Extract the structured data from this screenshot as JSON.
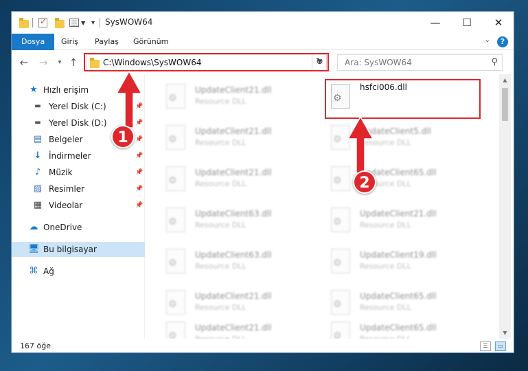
{
  "window": {
    "title": "SysWOW64",
    "controls": {
      "minimize": "—",
      "maximize": "☐",
      "close": "✕"
    }
  },
  "ribbon": {
    "tabs": [
      {
        "label": "Dosya",
        "active": true
      },
      {
        "label": "Giriş"
      },
      {
        "label": "Paylaş"
      },
      {
        "label": "Görünüm"
      }
    ],
    "help": "?"
  },
  "nav": {
    "address": "C:\\Windows\\SysWOW64",
    "search_placeholder": "Ara: SysWOW64"
  },
  "sidebar": {
    "items": [
      {
        "label": "Hızlı erişim",
        "icon": "star-icon",
        "pinned": false
      },
      {
        "label": "Yerel Disk (C:)",
        "icon": "drive-icon",
        "pinned": true
      },
      {
        "label": "Yerel Disk (D:)",
        "icon": "drive-icon",
        "pinned": true
      },
      {
        "label": "Belgeler",
        "icon": "documents-icon",
        "pinned": true
      },
      {
        "label": "İndirmeler",
        "icon": "downloads-icon",
        "pinned": true
      },
      {
        "label": "Müzik",
        "icon": "music-icon",
        "pinned": true
      },
      {
        "label": "Resimler",
        "icon": "pictures-icon",
        "pinned": true
      },
      {
        "label": "Videolar",
        "icon": "videos-icon",
        "pinned": true
      },
      {
        "label": "OneDrive",
        "icon": "cloud-icon",
        "pinned": false
      },
      {
        "label": "Bu bilgisayar",
        "icon": "computer-icon",
        "pinned": false,
        "selected": true
      },
      {
        "label": "Ağ",
        "icon": "network-icon",
        "pinned": false
      }
    ]
  },
  "files": [
    {
      "name": "UpdateClient21.dll",
      "type": "Resource DLL"
    },
    {
      "name": "hsfci006.dll",
      "type": ""
    },
    {
      "name": "UpdateClient21.dll",
      "type": "Resource DLL"
    },
    {
      "name": "UpdateClient5.dll",
      "type": "Resource DLL"
    },
    {
      "name": "UpdateClient21.dll",
      "type": "Resource DLL"
    },
    {
      "name": "UpdateClient65.dll",
      "type": "Resource DLL"
    },
    {
      "name": "UpdateClient63.dll",
      "type": "Resource DLL"
    },
    {
      "name": "UpdateClient21.dll",
      "type": "Resource DLL"
    },
    {
      "name": "UpdateClient63.dll",
      "type": "Resource DLL"
    },
    {
      "name": "UpdateClient19.dll",
      "type": "Resource DLL"
    },
    {
      "name": "UpdateClient21.dll",
      "type": "Resource DLL"
    },
    {
      "name": "UpdateClient65.dll",
      "type": "Resource DLL"
    },
    {
      "name": "UpdateClient21.dll",
      "type": "Resource DLL"
    },
    {
      "name": "UpdateClient65.dll",
      "type": "Resource DLL"
    }
  ],
  "status": {
    "count": "167 öğe"
  },
  "annotations": {
    "step1": "1",
    "step2": "2",
    "color": "#e0262d"
  }
}
